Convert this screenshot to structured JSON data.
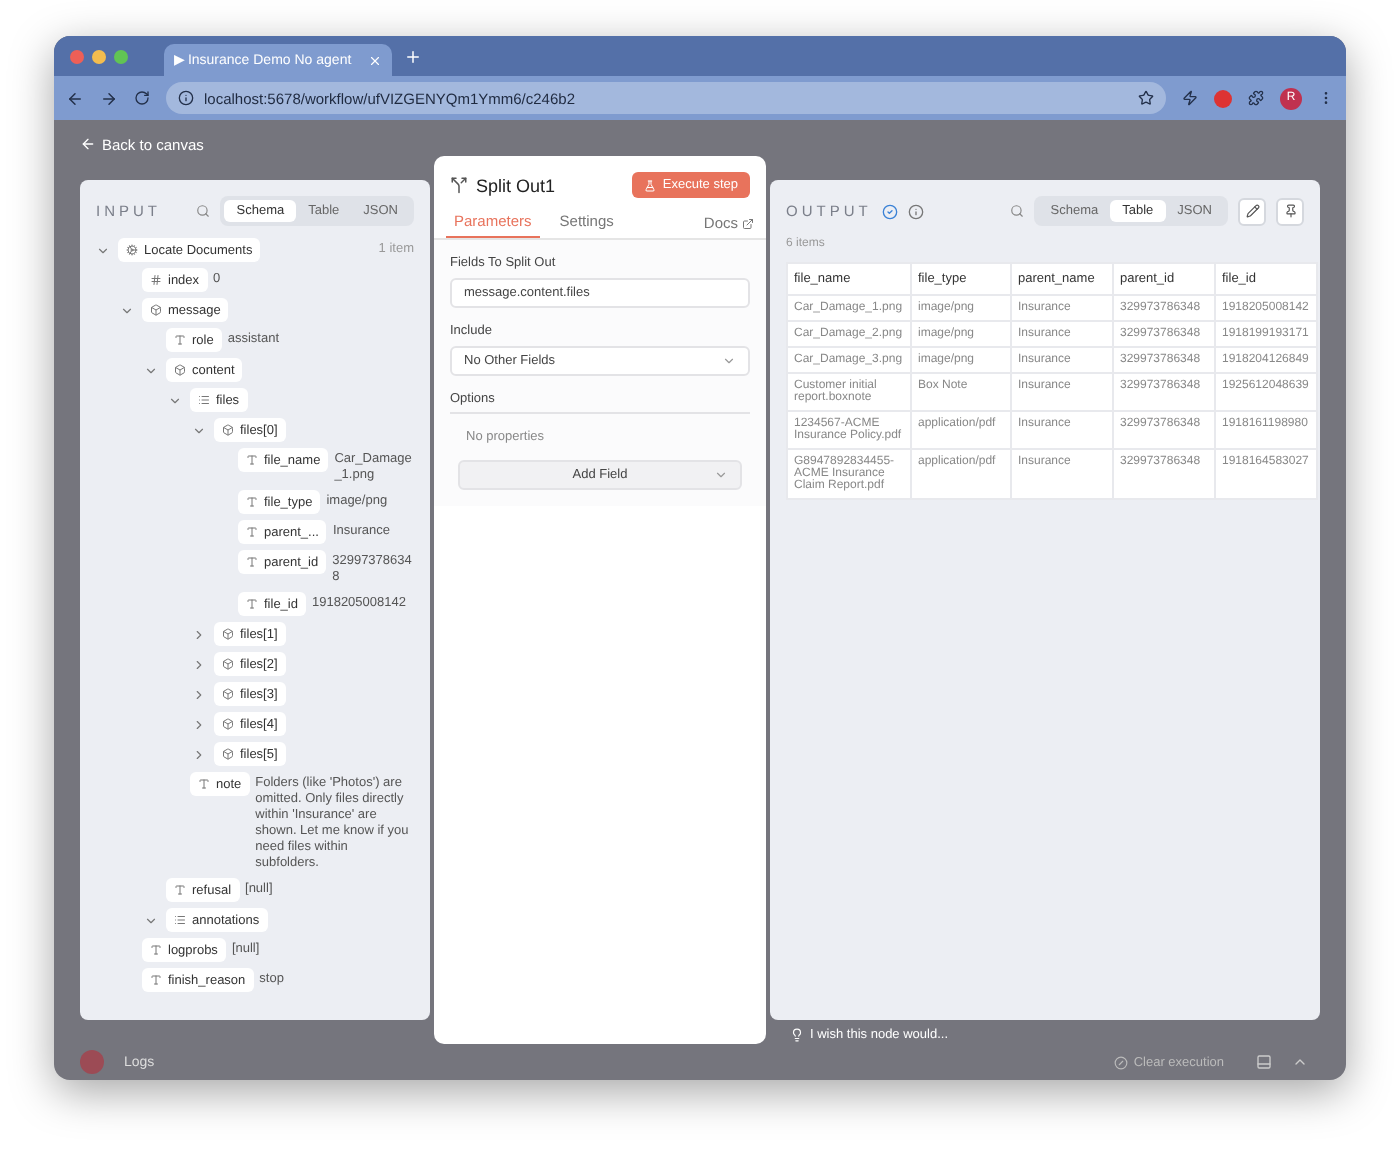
{
  "browser": {
    "tab_title": "▶ Insurance Demo No agent",
    "url": "localhost:5678/workflow/ufVIZGENYQm1Ymm6/c246b2",
    "profile_initial": "R"
  },
  "back_link": "Back to canvas",
  "input_panel": {
    "title": "INPUT",
    "views": [
      {
        "label": "Schema",
        "selected": true
      },
      {
        "label": "Table",
        "selected": false
      },
      {
        "label": "JSON",
        "selected": false
      }
    ],
    "tree": [
      {
        "kind": "node",
        "key": "Locate Documents",
        "count": "1 item",
        "expanded": true,
        "children": [
          {
            "kind": "number",
            "key": "index",
            "value": "0"
          },
          {
            "kind": "object",
            "key": "message",
            "expanded": true,
            "children": [
              {
                "kind": "string",
                "key": "role",
                "value": "assistant"
              },
              {
                "kind": "object",
                "key": "content",
                "expanded": true,
                "children": [
                  {
                    "kind": "array",
                    "key": "files",
                    "expanded": true,
                    "children": [
                      {
                        "kind": "object",
                        "key": "files[0]",
                        "expanded": true,
                        "children": [
                          {
                            "kind": "string",
                            "key": "file_name",
                            "value": "Car_Damage_1.png"
                          },
                          {
                            "kind": "string",
                            "key": "file_type",
                            "value": "image/png"
                          },
                          {
                            "kind": "string",
                            "key": "parent_...",
                            "value": "Insurance"
                          },
                          {
                            "kind": "string",
                            "key": "parent_id",
                            "value": "329973786348"
                          },
                          {
                            "kind": "string",
                            "key": "file_id",
                            "value": "1918205008142"
                          }
                        ]
                      },
                      {
                        "kind": "object",
                        "key": "files[1]",
                        "expanded": false
                      },
                      {
                        "kind": "object",
                        "key": "files[2]",
                        "expanded": false
                      },
                      {
                        "kind": "object",
                        "key": "files[3]",
                        "expanded": false
                      },
                      {
                        "kind": "object",
                        "key": "files[4]",
                        "expanded": false
                      },
                      {
                        "kind": "object",
                        "key": "files[5]",
                        "expanded": false
                      }
                    ]
                  },
                  {
                    "kind": "string",
                    "key": "note",
                    "value": "Folders (like 'Photos') are omitted. Only files directly within 'Insurance' are shown. Let me know if you need files within subfolders."
                  }
                ]
              },
              {
                "kind": "string",
                "key": "refusal",
                "value": "[null]"
              },
              {
                "kind": "array",
                "key": "annotations",
                "expanded": true
              }
            ]
          },
          {
            "kind": "string",
            "key": "logprobs",
            "value": "[null]"
          },
          {
            "kind": "string",
            "key": "finish_reason",
            "value": "stop"
          }
        ]
      }
    ]
  },
  "node_panel": {
    "title": "Split Out1",
    "execute_button": "Execute step",
    "tabs": [
      {
        "label": "Parameters",
        "selected": true
      },
      {
        "label": "Settings",
        "selected": false
      }
    ],
    "docs_link": "Docs",
    "fields": [
      {
        "kind": "text",
        "label": "Fields To Split Out",
        "value": "message.content.files"
      },
      {
        "kind": "select",
        "label": "Include",
        "value": "No Other Fields"
      }
    ],
    "options": {
      "label": "Options",
      "empty_text": "No properties",
      "add_button": "Add Field"
    }
  },
  "output_panel": {
    "title": "OUTPUT",
    "views": [
      {
        "label": "Schema",
        "selected": false
      },
      {
        "label": "Table",
        "selected": true
      },
      {
        "label": "JSON",
        "selected": false
      }
    ],
    "count": "6 items",
    "table": {
      "columns": [
        "file_name",
        "file_type",
        "parent_name",
        "parent_id",
        "file_id"
      ],
      "rows": [
        [
          "Car_Damage_1.png",
          "image/png",
          "Insurance",
          "329973786348",
          "1918205008142"
        ],
        [
          "Car_Damage_2.png",
          "image/png",
          "Insurance",
          "329973786348",
          "1918199193171"
        ],
        [
          "Car_Damage_3.png",
          "image/png",
          "Insurance",
          "329973786348",
          "1918204126849"
        ],
        [
          "Customer initial report.boxnote",
          "Box Note",
          "Insurance",
          "329973786348",
          "1925612048639"
        ],
        [
          "1234567-ACME Insurance Policy.pdf",
          "application/pdf",
          "Insurance",
          "329973786348",
          "1918161198980"
        ],
        [
          "G8947892834455-ACME Insurance Claim Report.pdf",
          "application/pdf",
          "Insurance",
          "329973786348",
          "1918164583027"
        ]
      ]
    }
  },
  "feedback_hint": "I wish this node would...",
  "footer": {
    "logs": "Logs",
    "clear_button": "Clear execution"
  }
}
